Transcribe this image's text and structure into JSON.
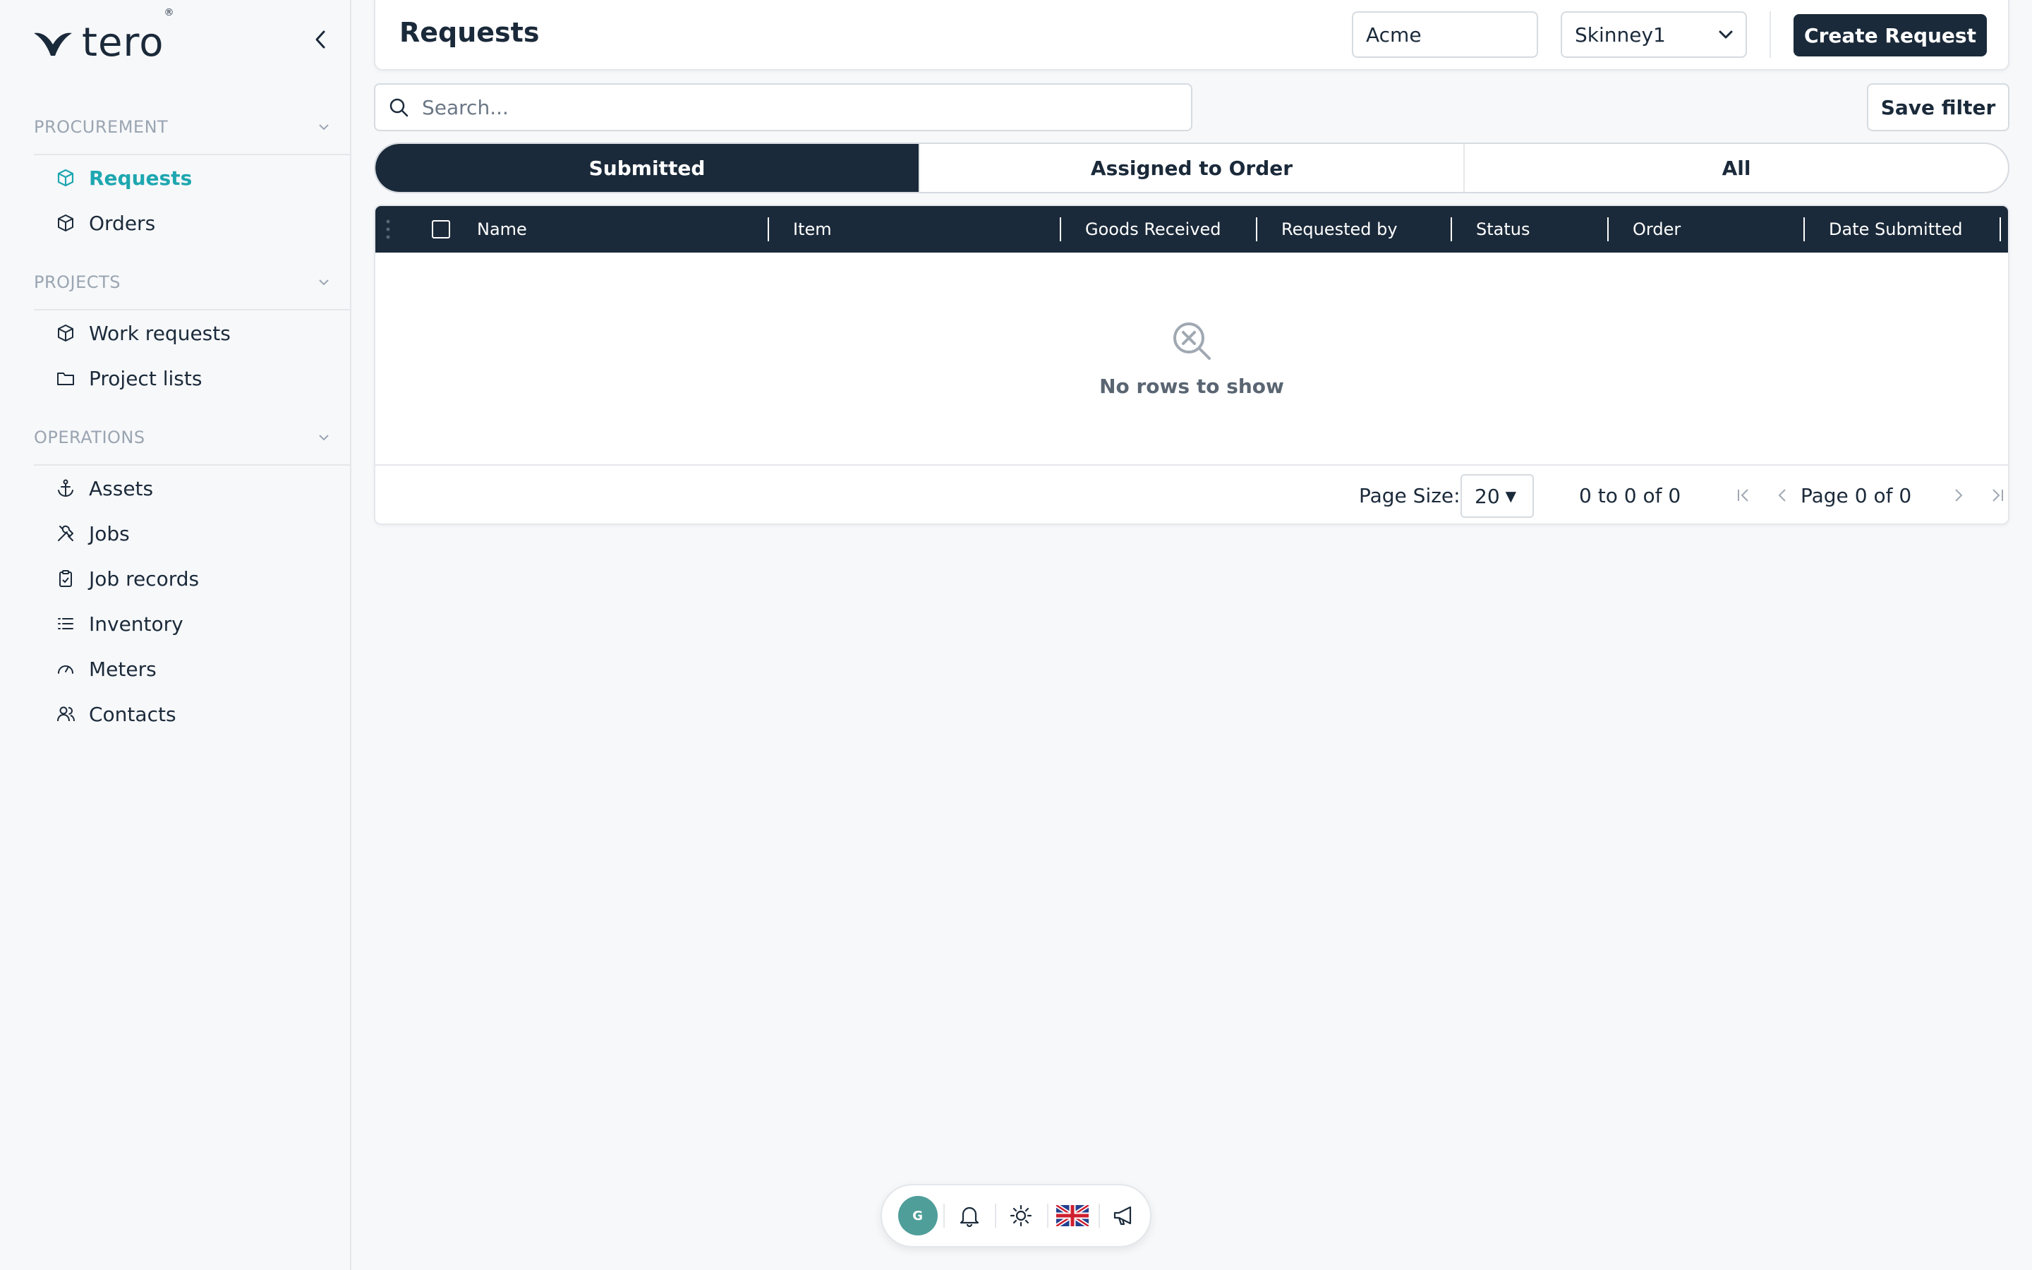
{
  "brand": {
    "name": "tero",
    "reg": "®",
    "accent": "#1ea7b0",
    "dark": "#1b2a3a"
  },
  "sidebar": {
    "sections": [
      {
        "title": "PROCUREMENT",
        "items": [
          {
            "label": "Requests",
            "icon": "cube-icon",
            "active": true
          },
          {
            "label": "Orders",
            "icon": "cube-icon"
          }
        ]
      },
      {
        "title": "PROJECTS",
        "items": [
          {
            "label": "Work requests",
            "icon": "cube-icon"
          },
          {
            "label": "Project lists",
            "icon": "folder-icon"
          }
        ]
      },
      {
        "title": "OPERATIONS",
        "items": [
          {
            "label": "Assets",
            "icon": "anchor-icon"
          },
          {
            "label": "Jobs",
            "icon": "tools-icon"
          },
          {
            "label": "Job records",
            "icon": "clipboard-icon"
          },
          {
            "label": "Inventory",
            "icon": "list-icon"
          },
          {
            "label": "Meters",
            "icon": "gauge-icon"
          },
          {
            "label": "Contacts",
            "icon": "users-icon"
          }
        ]
      }
    ]
  },
  "header": {
    "title": "Requests",
    "company_value": "Acme",
    "site_value": "Skinney1",
    "create_label": "Create Request"
  },
  "search": {
    "placeholder": "Search..."
  },
  "save_filter_label": "Save filter",
  "tabs": [
    {
      "label": "Submitted",
      "active": true
    },
    {
      "label": "Assigned to Order"
    },
    {
      "label": "All"
    }
  ],
  "table": {
    "columns": [
      "Name",
      "Item",
      "Goods Received",
      "Requested by",
      "Status",
      "Order",
      "Date Submitted"
    ],
    "rows": [],
    "empty_text": "No rows to show"
  },
  "pagination": {
    "page_size_label": "Page Size:",
    "page_size": "20",
    "range_text": "0 to 0 of 0",
    "page_word": "Page",
    "page_current": "0",
    "of_word": "of",
    "page_total": "0"
  },
  "bottom_bar": {
    "avatar_initial": "G",
    "avatar_color": "#4f9e9a"
  }
}
